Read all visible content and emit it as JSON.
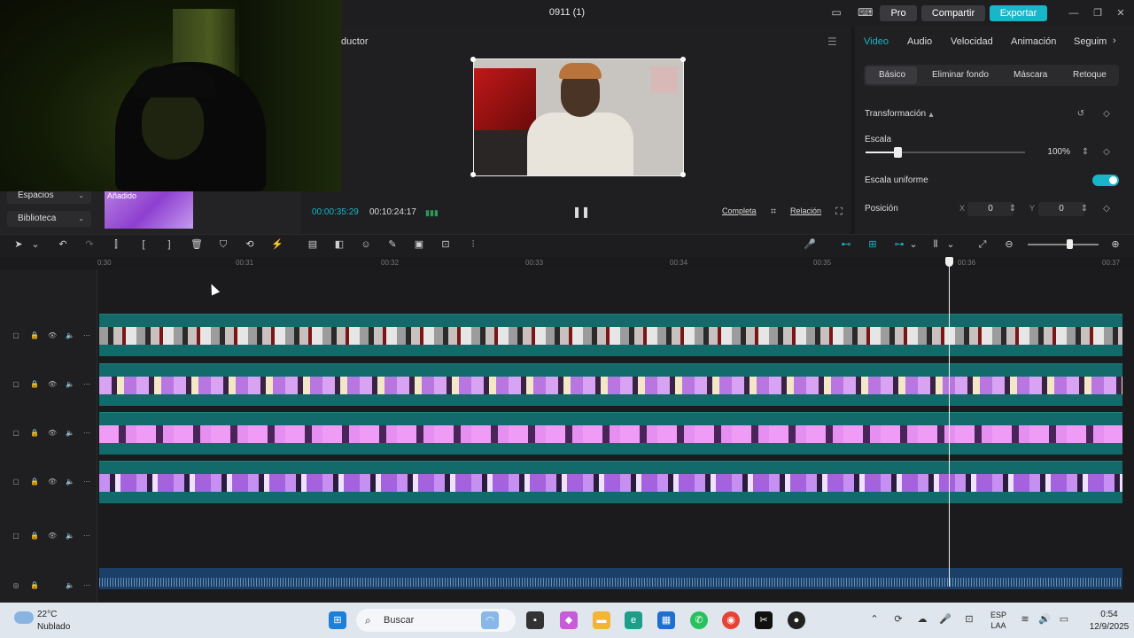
{
  "app": {
    "title": "0911 (1)",
    "pro_label": "Pro",
    "share_label": "Compartir",
    "export_label": "Exportar",
    "accent_color": "#18b6c8"
  },
  "left_panel": {
    "items": [
      {
        "label": "Espacios"
      },
      {
        "label": "Biblioteca"
      }
    ],
    "added_label": "Añadido"
  },
  "player": {
    "title": "ductor",
    "timecode_current": "00:00:35:29",
    "timecode_total": "00:10:24:17",
    "full_label": "Completa",
    "ratio_label": "Relación"
  },
  "inspector": {
    "tabs": [
      "Video",
      "Audio",
      "Velocidad",
      "Animación",
      "Seguim"
    ],
    "subtabs": [
      "Básico",
      "Eliminar fondo",
      "Máscara",
      "Retoque"
    ],
    "section_title": "Transformación",
    "scale_label": "Escala",
    "scale_value": "100%",
    "scale_fraction": 0.2,
    "uniform_label": "Escala uniforme",
    "uniform_on": true,
    "position_label": "Posición",
    "pos_x_label": "X",
    "pos_x": "0",
    "pos_y_label": "Y",
    "pos_y": "0"
  },
  "timeline": {
    "ruler_labels": [
      "0:30",
      "00:31",
      "00:32",
      "00:33",
      "00:34",
      "00:35",
      "00:36",
      "00:37"
    ]
  },
  "taskbar": {
    "weather_temp": "22°C",
    "weather_desc": "Nublado",
    "search_placeholder": "Buscar",
    "language_line1": "ESP",
    "language_line2": "LAA",
    "time": "0:54",
    "date": "12/9/2025"
  }
}
